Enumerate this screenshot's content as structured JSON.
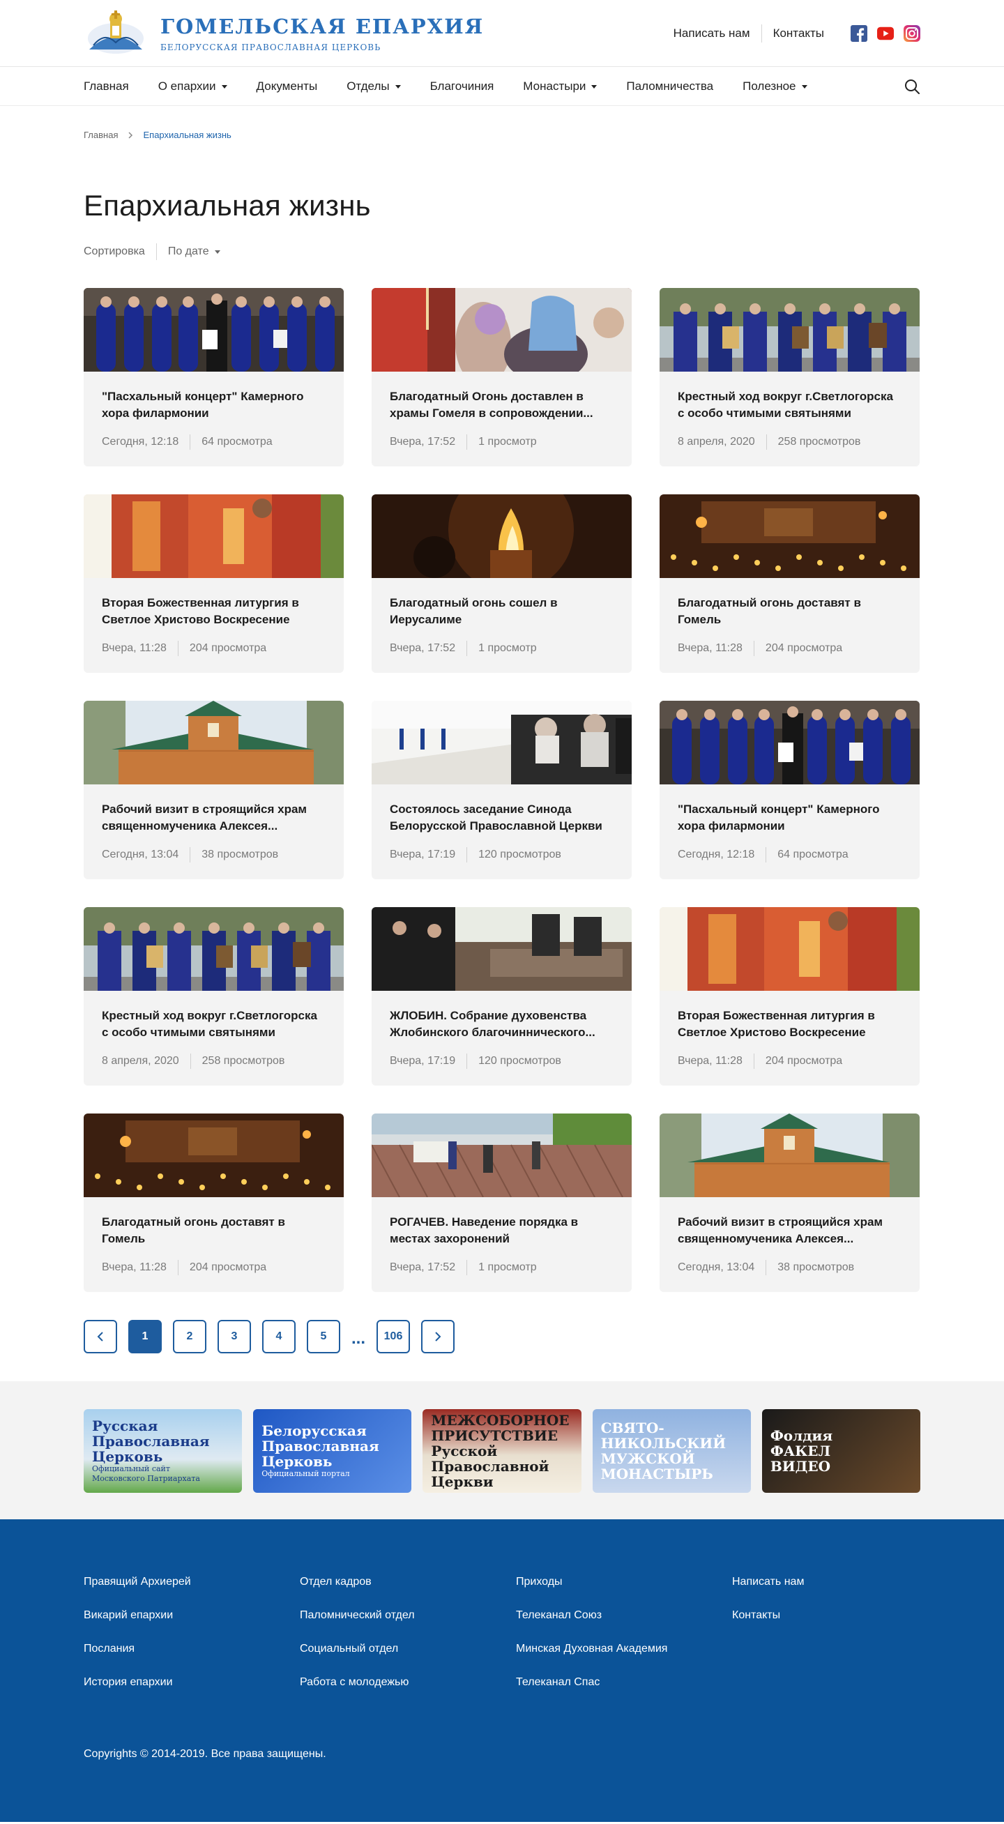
{
  "header": {
    "logo_title": "ГОМЕЛЬСКАЯ ЕПАРХИЯ",
    "logo_subtitle": "БЕЛОРУССКАЯ ПРАВОСЛАВНАЯ ЦЕРКОВЬ",
    "write_us": "Написать нам",
    "contacts": "Контакты",
    "social": [
      "facebook-icon",
      "youtube-icon",
      "instagram-icon"
    ]
  },
  "nav": {
    "items": [
      {
        "label": "Главная",
        "dropdown": false
      },
      {
        "label": "О епархии",
        "dropdown": true
      },
      {
        "label": "Документы",
        "dropdown": false
      },
      {
        "label": "Отделы",
        "dropdown": true
      },
      {
        "label": "Благочиния",
        "dropdown": false
      },
      {
        "label": "Монастыри",
        "dropdown": true
      },
      {
        "label": "Паломничества",
        "dropdown": false
      },
      {
        "label": "Полезное",
        "dropdown": true
      }
    ]
  },
  "breadcrumb": {
    "home": "Главная",
    "current": "Епархиальная жизнь"
  },
  "page": {
    "title": "Епархиальная жизнь",
    "sort_label": "Сортировка",
    "sort_value": "По дате"
  },
  "cards": [
    {
      "title": "\"Пасхальный концерт\" Камерного хора филармонии",
      "date": "Сегодня, 12:18",
      "views": "64 просмотра",
      "image": "choir"
    },
    {
      "title": "Благодатный Огонь доставлен в храмы Гомеля в сопровождении...",
      "date": "Вчера, 17:52",
      "views": "1 просмотр",
      "image": "candles-women"
    },
    {
      "title": "Крестный ход вокруг г.Светлогорска с особо чтимыми святынями",
      "date": "8 апреля, 2020",
      "views": "258 просмотров",
      "image": "procession"
    },
    {
      "title": "Вторая Божественная литургия в Светлое Христово Воскресение",
      "date": "Вчера, 11:28",
      "views": "204 просмотра",
      "image": "liturgy"
    },
    {
      "title": "Благодатный огонь сошел в Иерусалиме",
      "date": "Вчера, 17:52",
      "views": "1 просмотр",
      "image": "fire"
    },
    {
      "title": "Благодатный огонь доставят в Гомель",
      "date": "Вчера, 11:28",
      "views": "204 просмотра",
      "image": "temple-fire"
    },
    {
      "title": "Рабочий визит в строящийся храм священномученика Алексея...",
      "date": "Сегодня, 13:04",
      "views": "38 просмотров",
      "image": "wooden-church"
    },
    {
      "title": "Состоялось заседание Синода Белорусской Православной Церкви",
      "date": "Вчера, 17:19",
      "views": "120 просмотров",
      "image": "synod"
    },
    {
      "title": "\"Пасхальный концерт\" Камерного хора филармонии",
      "date": "Сегодня, 12:18",
      "views": "64 просмотра",
      "image": "choir"
    },
    {
      "title": "Крестный ход вокруг г.Светлогорска с особо чтимыми святынями",
      "date": "8 апреля, 2020",
      "views": "258 просмотров",
      "image": "procession"
    },
    {
      "title": "ЖЛОБИН. Собрание духовенства Жлобинского благочиннического...",
      "date": "Вчера, 17:19",
      "views": "120 просмотров",
      "image": "meeting"
    },
    {
      "title": "Вторая Божественная литургия в Светлое Христово Воскресение",
      "date": "Вчера, 11:28",
      "views": "204 просмотра",
      "image": "liturgy"
    },
    {
      "title": "Благодатный огонь доставят в Гомель",
      "date": "Вчера, 11:28",
      "views": "204 просмотра",
      "image": "temple-fire"
    },
    {
      "title": "РОГАЧЕВ. Наведение порядка в местах захоронений",
      "date": "Вчера, 17:52",
      "views": "1 просмотр",
      "image": "cleanup"
    },
    {
      "title": "Рабочий визит в строящийся храм священномученика Алексея...",
      "date": "Сегодня, 13:04",
      "views": "38 просмотров",
      "image": "wooden-church"
    }
  ],
  "pagination": {
    "pages": [
      "1",
      "2",
      "3",
      "4",
      "5"
    ],
    "dots": "...",
    "last": "106",
    "current": "1"
  },
  "partners": [
    {
      "name": "russian-church-banner",
      "line1": "Русская",
      "line2": "Православная",
      "line3": "Церковь",
      "line4": "Официальный сайт",
      "line5": "Московского Патриархата"
    },
    {
      "name": "belarus-church-banner",
      "line1": "Белорусская",
      "line2": "Православная",
      "line3": "Церковь",
      "line4": "Официальный портал"
    },
    {
      "name": "mezhsobornoe-banner",
      "line1": "МЕЖСОБОРНОЕ",
      "line2": "ПРИСУТСТВИЕ",
      "line3": "Русской Православной Церкви"
    },
    {
      "name": "svyato-nikolsky-banner",
      "line1": "СВЯТО-НИКОЛЬСКИЙ",
      "line2": "МУЖСКОЙ МОНАСТЫРЬ"
    },
    {
      "name": "fakel-video-banner",
      "line1": "Фолдия",
      "line2": "ФАКЕЛ",
      "line3": "ВИДЕО"
    }
  ],
  "footer": {
    "columns": [
      [
        "Правящий Архиерей",
        "Викарий епархии",
        "Послания",
        "История епархии"
      ],
      [
        "Отдел кадров",
        "Паломнический отдел",
        "Социальный отдел",
        "Работа с молодежью"
      ],
      [
        "Приходы",
        "Телеканал Союз",
        "Минская Духовная Академия",
        "Телеканал Спас"
      ],
      [
        "Написать нам",
        "Контакты"
      ]
    ],
    "copyright": "Copyrights © 2014-2019. Все права защищены."
  },
  "colors": {
    "accent": "#1e5c9e",
    "footer_bg": "#0b5398",
    "card_bg": "#f3f3f3",
    "logo_blue": "#2a6fb9"
  }
}
